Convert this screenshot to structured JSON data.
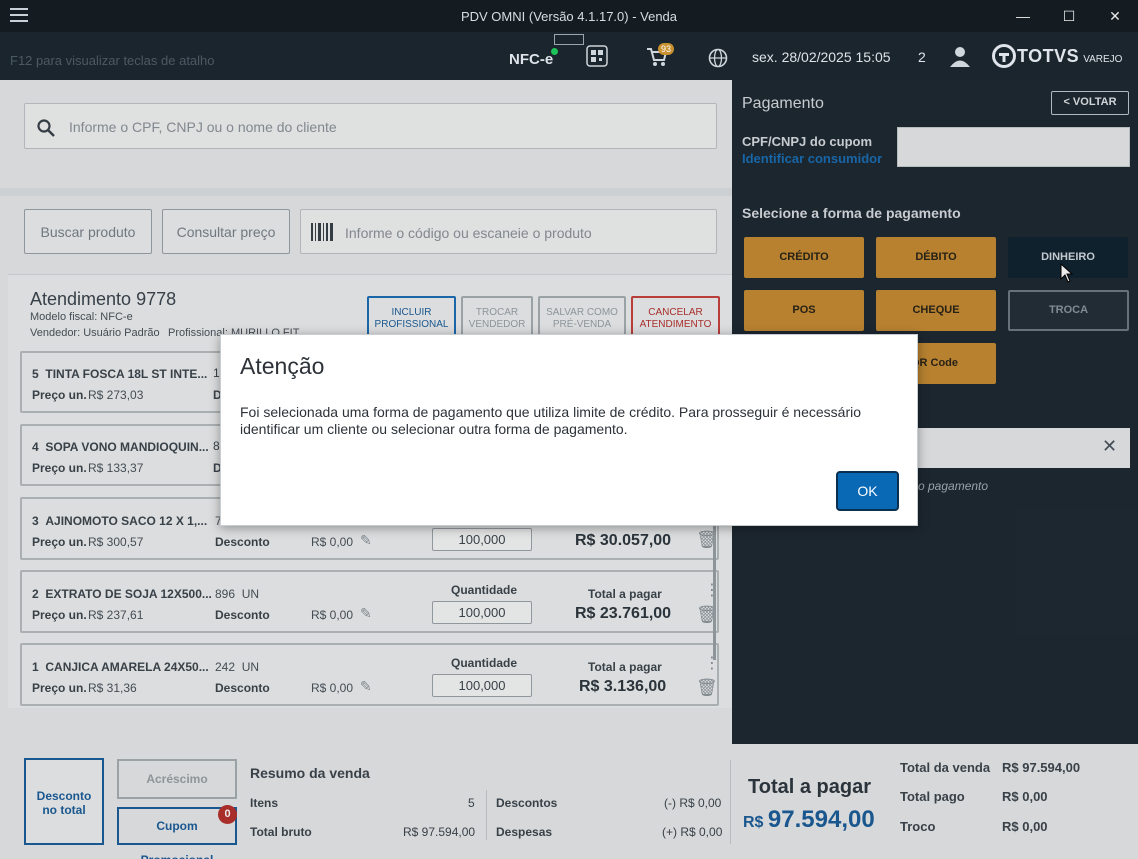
{
  "window": {
    "title": "PDV OMNI (Versão 4.1.17.0) - Venda",
    "minimize": "—",
    "maximize": "☐",
    "close": "✕"
  },
  "header": {
    "shortcut_hint": "F12 para visualizar teclas de atalho",
    "fiscal_label": "NFC-e",
    "cart_badge": "93",
    "datetime": "sex. 28/02/2025 15:05",
    "counter": "2",
    "brand": "TOTVS",
    "brand_suffix": "VAREJO"
  },
  "customer_search": {
    "placeholder": "Informe o CPF, CNPJ ou o nome do cliente"
  },
  "product_bar": {
    "search_button": "Buscar produto",
    "price_button": "Consultar preço",
    "code_placeholder": "Informe o código ou escaneie o produto"
  },
  "attendance": {
    "title": "Atendimento 9778",
    "fiscal_model": "Modelo fiscal: NFC-e",
    "seller": "Vendedor: Usuário Padrão",
    "professional": "Profissional: MURILLO FIT",
    "actions": {
      "include_prof": [
        "INCLUIR",
        "PROFISSIONAL"
      ],
      "change_seller": [
        "TROCAR",
        "VENDEDOR"
      ],
      "save_presale": [
        "SALVAR COMO",
        "PRÉ-VENDA"
      ],
      "cancel": [
        "CANCELAR",
        "ATENDIMENTO"
      ]
    }
  },
  "items": [
    {
      "index": "5",
      "name": "TINTA FOSCA 18L ST INTE...",
      "code": "1",
      "unit_label": "Preço un.",
      "unit_price": "R$ 273,03",
      "disc_prefix": "D"
    },
    {
      "index": "4",
      "name": "SOPA VONO MANDIOQUIN...",
      "code": "8",
      "unit_label": "Preço un.",
      "unit_price": "R$ 133,37",
      "disc_prefix": "D"
    },
    {
      "index": "3",
      "name": "AJINOMOTO SACO 12 X 1,...",
      "code": "7",
      "unit_label": "Preço un.",
      "unit_price": "R$ 300,57",
      "disc_label": "Desconto",
      "disc_value": "R$ 0,00",
      "qty": "100,000",
      "total": "R$ 30.057,00"
    },
    {
      "index": "2",
      "name": "EXTRATO DE SOJA 12X500...",
      "code": "896",
      "unit": "UN",
      "unit_label": "Preço un.",
      "unit_price": "R$ 237,61",
      "disc_label": "Desconto",
      "disc_value": "R$ 0,00",
      "qty_label": "Quantidade",
      "qty": "100,000",
      "total_label": "Total a pagar",
      "total": "R$ 23.761,00"
    },
    {
      "index": "1",
      "name": "CANJICA AMARELA 24X50...",
      "code": "242",
      "unit": "UN",
      "unit_label": "Preço un.",
      "unit_price": "R$ 31,36",
      "disc_label": "Desconto",
      "disc_value": "R$ 0,00",
      "qty_label": "Quantidade",
      "qty": "100,000",
      "total_label": "Total a pagar",
      "total": "R$ 3.136,00"
    }
  ],
  "payment": {
    "title": "Pagamento",
    "back": "< VOLTAR",
    "cpf_label": "CPF/CNPJ do cupom",
    "identify": "Identificar consumidor",
    "select_label": "Selecione a forma de pagamento",
    "methods": [
      "CRÉDITO",
      "DÉBITO",
      "DINHEIRO",
      "POS",
      "CHEQUE",
      "TROCA",
      "QR Code"
    ],
    "method_qr_visible": "QR Code",
    "hint_visible": "o pagamento",
    "clear": "✕"
  },
  "summary": {
    "discount_total": [
      "Desconto",
      "no total"
    ],
    "surcharge": "Acréscimo",
    "coupon": "Cupom Promocional",
    "coupon_badge": "0",
    "title": "Resumo da venda",
    "items_label": "Itens",
    "items_value": "5",
    "gross_label": "Total bruto",
    "gross_value": "R$ 97.594,00",
    "disc_label": "Descontos",
    "disc_value": "(-) R$ 0,00",
    "exp_label": "Despesas",
    "exp_value": "(+) R$ 0,00",
    "to_pay_label": "Total a pagar",
    "to_pay_currency": "R$",
    "to_pay_value": "97.594,00",
    "sale_total_label": "Total da venda",
    "sale_total_value": "R$ 97.594,00",
    "paid_label": "Total pago",
    "paid_value": "R$ 0,00",
    "change_label": "Troco",
    "change_value": "R$ 0,00"
  },
  "modal": {
    "title": "Atenção",
    "message": "Foi selecionada uma forma de pagamento que utiliza limite de crédito. Para prosseguir é necessário identificar um cliente ou selecionar outra forma de pagamento.",
    "ok": "OK"
  }
}
